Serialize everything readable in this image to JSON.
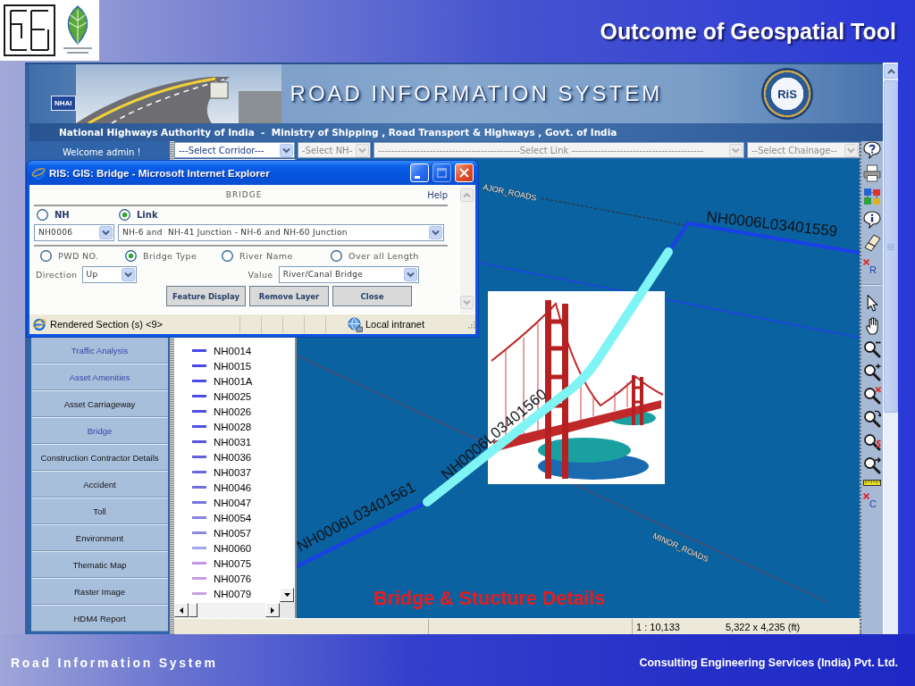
{
  "slide": {
    "title": "Outcome of Geospatial Tool"
  },
  "banner": {
    "agency_logo": "NHAI",
    "title": "ROAD INFORMATION SYSTEM",
    "emblem": "RiS",
    "subtitle": "National Highways Authority of India  -  Ministry of Shipping , Road Transport & Highways , Govt. of India"
  },
  "welcome": "Welcome admin !",
  "select_bar": [
    {
      "value": "---Select Corridor---",
      "disabled": false
    },
    {
      "value": "-Select NH-",
      "disabled": true
    },
    {
      "value": "--------------------------------------------Select Link -----------------------------------------",
      "disabled": true
    },
    {
      "value": "--Select Chainage--",
      "disabled": true
    }
  ],
  "sidebar": {
    "items": [
      {
        "label": "Traffic Analysis",
        "visited": true
      },
      {
        "label": "Asset Amenities",
        "visited": true
      },
      {
        "label": "Asset Carriageway",
        "visited": false
      },
      {
        "label": "Bridge",
        "visited": true
      },
      {
        "label": "Construction Contractor Details",
        "visited": false
      },
      {
        "label": "Accident",
        "visited": false
      },
      {
        "label": "Toll",
        "visited": false
      },
      {
        "label": "Environment",
        "visited": false
      },
      {
        "label": "Thematic Map",
        "visited": false
      },
      {
        "label": "Raster Image",
        "visited": false
      },
      {
        "label": "HDM4 Report",
        "visited": false
      }
    ]
  },
  "legend": {
    "items": [
      {
        "label": "NH0014",
        "color": "#4848e8"
      },
      {
        "label": "NH0015",
        "color": "#4848e8"
      },
      {
        "label": "NH001A",
        "color": "#4a4ae6"
      },
      {
        "label": "NH0025",
        "color": "#4c4ce6"
      },
      {
        "label": "NH0026",
        "color": "#4e4ee4"
      },
      {
        "label": "NH0028",
        "color": "#5050e4"
      },
      {
        "label": "NH0031",
        "color": "#5656e0"
      },
      {
        "label": "NH0036",
        "color": "#6262de"
      },
      {
        "label": "NH0037",
        "color": "#6868de"
      },
      {
        "label": "NH0046",
        "color": "#7070e0"
      },
      {
        "label": "NH0047",
        "color": "#7676e2"
      },
      {
        "label": "NH0054",
        "color": "#8484e4"
      },
      {
        "label": "NH0057",
        "color": "#8a8ae6"
      },
      {
        "label": "NH0060",
        "color": "#a0a8ec"
      },
      {
        "label": "NH0075",
        "color": "#c496e6"
      },
      {
        "label": "NH0076",
        "color": "#c49ae6"
      },
      {
        "label": "NH0079",
        "color": "#c8a0e8"
      }
    ]
  },
  "map": {
    "road_labels": [
      "AJOR_ROADS",
      "MINOR_ROADS"
    ],
    "segments": [
      {
        "label": "NH0006L03401559",
        "selected": false
      },
      {
        "label": "NH0006L03401560",
        "selected": true
      },
      {
        "label": "NH0006L03401561",
        "selected": false
      }
    ],
    "caption": "Bridge & Stucture Details",
    "status": {
      "scale": "1 : 10,133",
      "extent": "5,322 x 4,235 (ft)"
    }
  },
  "toolbar": [
    {
      "kind": "help"
    },
    {
      "kind": "print"
    },
    {
      "kind": "layers"
    },
    {
      "kind": "info"
    },
    {
      "kind": "eraser"
    },
    {
      "kind": "clear",
      "label": "R"
    },
    {
      "kind": "separator"
    },
    {
      "kind": "select"
    },
    {
      "kind": "pan"
    },
    {
      "kind": "zoom_out"
    },
    {
      "kind": "zoom_in"
    },
    {
      "kind": "zoom_clear"
    },
    {
      "kind": "zoom_back"
    },
    {
      "kind": "zoom_mark"
    },
    {
      "kind": "zoom_next"
    },
    {
      "kind": "measure"
    },
    {
      "kind": "clear",
      "label": "C"
    }
  ],
  "dialog": {
    "title": "RIS: GIS: Bridge - Microsoft Internet Explorer",
    "window_buttons": [
      {
        "kind": "minimize",
        "disabled": false
      },
      {
        "kind": "maximize",
        "disabled": true
      },
      {
        "kind": "close",
        "disabled": false
      }
    ],
    "heading": "BRIDGE",
    "help": "Help",
    "mode_options": [
      {
        "label": "NH",
        "selected": false
      },
      {
        "label": "Link",
        "selected": true
      }
    ],
    "road_select": "NH0006",
    "link_select": "NH-6 and  NH-41 Junction - NH-6 and NH-60 Junction",
    "filter_options": [
      {
        "label": "PWD NO.",
        "selected": false
      },
      {
        "label": "Bridge Type",
        "selected": true
      },
      {
        "label": "River Name",
        "selected": false
      },
      {
        "label": "Over all Length",
        "selected": false
      }
    ],
    "direction": {
      "label": "Direction",
      "value": "Up"
    },
    "value": {
      "label": "Value",
      "value": "River/Canal Bridge"
    },
    "buttons": [
      "Feature Display",
      "Remove Layer",
      "Close"
    ],
    "status": "Rendered Section (s) <9>",
    "zone": "Local intranet"
  },
  "footer": {
    "left": "Road Information System",
    "right": "Consulting Engineering Services (India) Pvt. Ltd."
  }
}
